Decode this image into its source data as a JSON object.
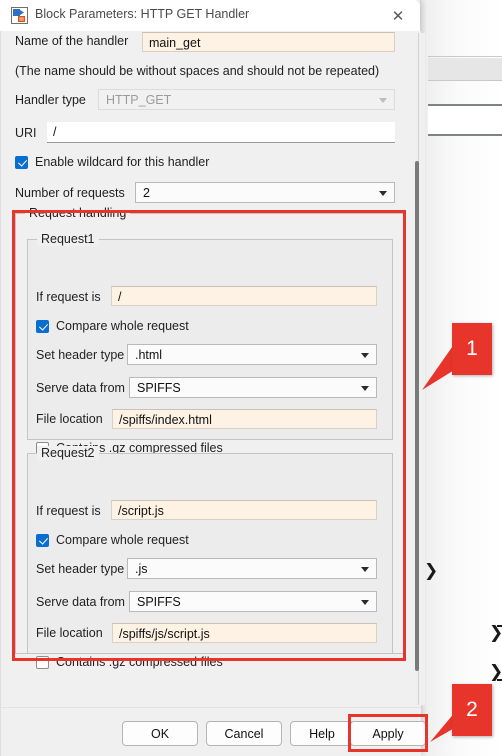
{
  "window": {
    "title": "Block Parameters: HTTP GET Handler",
    "icon": "simulink-block-icon",
    "close_label": "✕"
  },
  "form": {
    "handler_name": {
      "label": "Name of the handler",
      "value": "main_get"
    },
    "hint": "(The name should be without spaces and should not be repeated)",
    "handler_type": {
      "label": "Handler type",
      "value": "HTTP_GET",
      "disabled": true
    },
    "uri": {
      "label": "URI",
      "value": "/"
    },
    "enable_wildcard": {
      "label": "Enable wildcard for this handler",
      "checked": true
    },
    "number_of_requests": {
      "label": "Number of requests",
      "value": "2"
    }
  },
  "request_handling": {
    "group_label": "Request handling",
    "requests": [
      {
        "group_label": "Request1",
        "if_request_is": {
          "label": "If request is",
          "value": "/"
        },
        "compare_whole_request": {
          "label": "Compare whole request",
          "checked": true
        },
        "set_header_type": {
          "label": "Set header type",
          "value": ".html"
        },
        "serve_data_from": {
          "label": "Serve data from",
          "value": "SPIFFS"
        },
        "file_location": {
          "label": "File location",
          "value": "/spiffs/index.html"
        },
        "contains_gz": {
          "label": "Contains .gz compressed files",
          "checked": false
        }
      },
      {
        "group_label": "Request2",
        "if_request_is": {
          "label": "If request is",
          "value": "/script.js"
        },
        "compare_whole_request": {
          "label": "Compare whole request",
          "checked": true
        },
        "set_header_type": {
          "label": "Set header type",
          "value": ".js"
        },
        "serve_data_from": {
          "label": "Serve data from",
          "value": "SPIFFS"
        },
        "file_location": {
          "label": "File location",
          "value": "/spiffs/js/script.js"
        },
        "contains_gz": {
          "label": "Contains .gz compressed files",
          "checked": false
        }
      }
    ]
  },
  "footer": {
    "ok": "OK",
    "cancel": "Cancel",
    "help": "Help",
    "apply": "Apply"
  },
  "annotations": {
    "accent_color": "#e8352c",
    "badges": [
      {
        "label": "1",
        "points_to": "request-handling-group"
      },
      {
        "label": "2",
        "points_to": "apply-button"
      }
    ]
  }
}
